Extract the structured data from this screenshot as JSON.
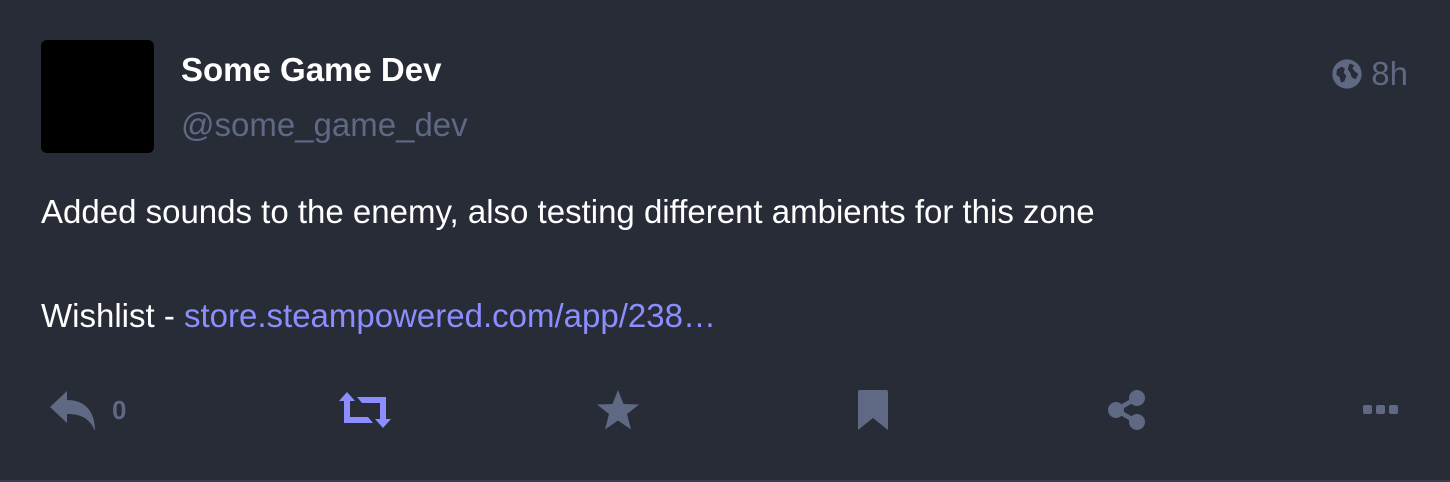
{
  "account": {
    "display_name": "Some Game Dev",
    "handle": "@some_game_dev"
  },
  "meta": {
    "visibility_icon": "globe-icon",
    "time_ago": "8h"
  },
  "content": {
    "line1": "Added sounds to the enemy, also testing different ambients for this zone",
    "wishlist_prefix": "Wishlist - ",
    "link_text": "store.steampowered.com/app/238…"
  },
  "actions": {
    "reply_icon": "reply-icon",
    "reply_count": "0",
    "boost_icon": "retweet-icon",
    "favourite_icon": "star-icon",
    "bookmark_icon": "bookmark-icon",
    "share_icon": "share-icon",
    "more_icon": "ellipsis-icon"
  },
  "colors": {
    "background": "#282c37",
    "text": "#ffffff",
    "muted": "#606984",
    "accent": "#8c8dff"
  }
}
